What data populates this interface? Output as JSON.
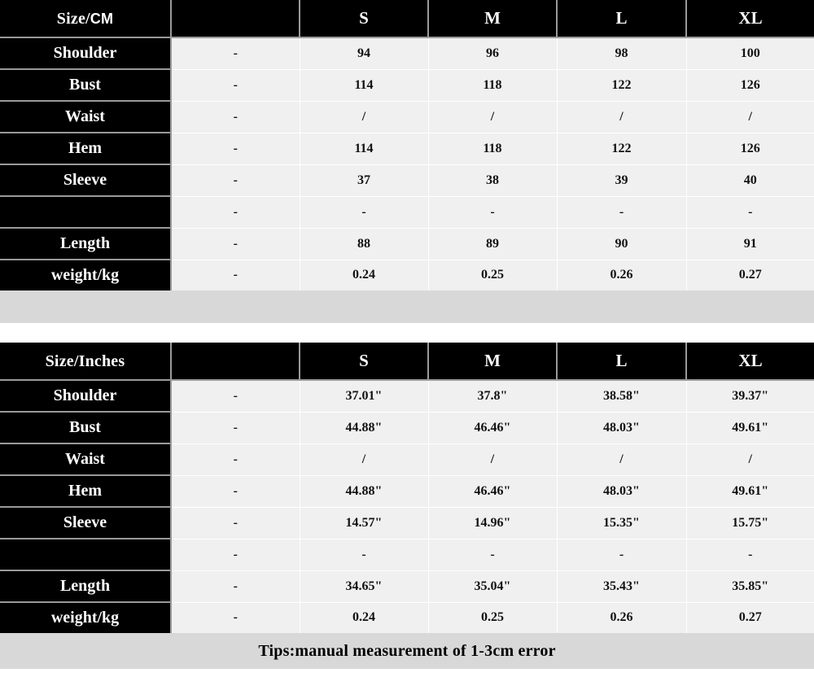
{
  "colors": {
    "header_bg": "#000000",
    "header_text": "#ffffff",
    "cell_bg": "#f0f0f0",
    "cell_text": "#111111",
    "band_gray": "#d8d8d8",
    "page_bg": "#ffffff",
    "grid_line": "#9a9a9a"
  },
  "tables": [
    {
      "id": "cm-table",
      "header": {
        "title_main": "Size/",
        "title_unit": "CM",
        "blank_label": "",
        "sizes": [
          "S",
          "M",
          "L",
          "XL"
        ]
      },
      "rows": [
        {
          "label": "Shoulder",
          "blank": "-",
          "values": [
            "94",
            "96",
            "98",
            "100"
          ]
        },
        {
          "label": "Bust",
          "blank": "-",
          "values": [
            "114",
            "118",
            "122",
            "126"
          ]
        },
        {
          "label": "Waist",
          "blank": "-",
          "values": [
            "/",
            "/",
            "/",
            "/"
          ]
        },
        {
          "label": "Hem",
          "blank": "-",
          "values": [
            "114",
            "118",
            "122",
            "126"
          ]
        },
        {
          "label": "Sleeve",
          "blank": "-",
          "values": [
            "37",
            "38",
            "39",
            "40"
          ]
        },
        {
          "label": "",
          "blank": "-",
          "values": [
            "-",
            "-",
            "-",
            "-"
          ]
        },
        {
          "label": "Length",
          "blank": "-",
          "values": [
            "88",
            "89",
            "90",
            "91"
          ]
        },
        {
          "label": "weight/kg",
          "blank": "-",
          "values": [
            "0.24",
            "0.25",
            "0.26",
            "0.27"
          ]
        }
      ]
    },
    {
      "id": "inches-table",
      "header": {
        "title_main": "Size/Inches",
        "title_unit": "",
        "blank_label": "",
        "sizes": [
          "S",
          "M",
          "L",
          "XL"
        ]
      },
      "rows": [
        {
          "label": "Shoulder",
          "blank": "-",
          "values": [
            "37.01\"",
            "37.8\"",
            "38.58\"",
            "39.37\""
          ]
        },
        {
          "label": "Bust",
          "blank": "-",
          "values": [
            "44.88\"",
            "46.46\"",
            "48.03\"",
            "49.61\""
          ]
        },
        {
          "label": "Waist",
          "blank": "-",
          "values": [
            "/",
            "/",
            "/",
            "/"
          ]
        },
        {
          "label": "Hem",
          "blank": "-",
          "values": [
            "44.88\"",
            "46.46\"",
            "48.03\"",
            "49.61\""
          ]
        },
        {
          "label": "Sleeve",
          "blank": "-",
          "values": [
            "14.57\"",
            "14.96\"",
            "15.35\"",
            "15.75\""
          ]
        },
        {
          "label": "",
          "blank": "-",
          "values": [
            "-",
            "-",
            "-",
            "-"
          ]
        },
        {
          "label": "Length",
          "blank": "-",
          "values": [
            "34.65\"",
            "35.04\"",
            "35.43\"",
            "35.85\""
          ]
        },
        {
          "label": "weight/kg",
          "blank": "-",
          "values": [
            "0.24",
            "0.25",
            "0.26",
            "0.27"
          ]
        }
      ]
    }
  ],
  "footer": {
    "tips": "Tips:manual measurement of 1-3cm error"
  }
}
